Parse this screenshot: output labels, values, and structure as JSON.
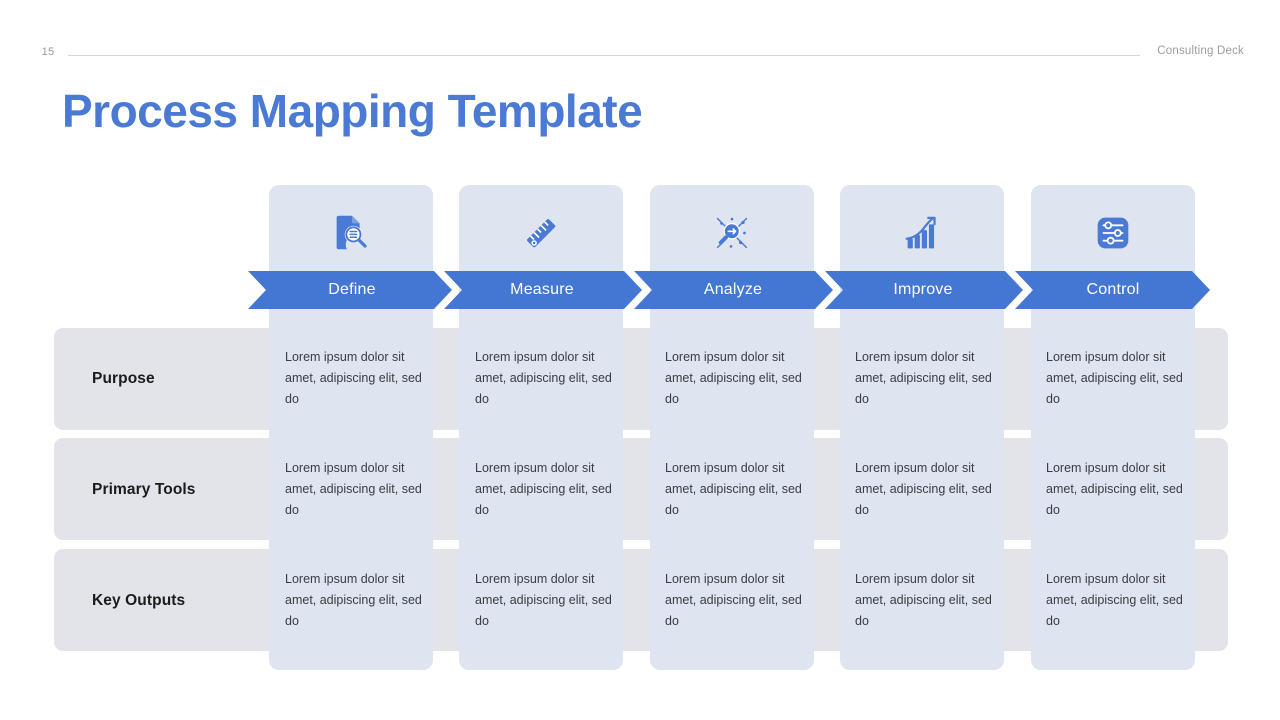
{
  "header": {
    "slide_number": "15",
    "deck_label": "Consulting Deck"
  },
  "title": "Process Mapping Template",
  "colors": {
    "title_blue": "#4a7ad4",
    "chevron_blue": "#4477d4",
    "column_card": "#dfe4f1",
    "row_band": "#e2e4ea",
    "icon_blue": "#4a7ad4",
    "body_text": "#3a3c41",
    "label_text": "#1b1b1b",
    "muted_text": "#9d9d9d"
  },
  "phases": [
    {
      "label": "Define",
      "icon": "document-search-icon"
    },
    {
      "label": "Measure",
      "icon": "ruler-icon"
    },
    {
      "label": "Analyze",
      "icon": "data-analysis-icon"
    },
    {
      "label": "Improve",
      "icon": "growth-chart-icon"
    },
    {
      "label": "Control",
      "icon": "sliders-settings-icon"
    }
  ],
  "rows": [
    {
      "label": "Purpose",
      "cells": [
        "Lorem ipsum dolor sit amet, adipiscing elit, sed do",
        "Lorem ipsum dolor sit amet, adipiscing elit, sed do",
        "Lorem ipsum dolor sit amet, adipiscing elit, sed do",
        "Lorem ipsum dolor sit amet, adipiscing elit, sed do",
        "Lorem ipsum dolor sit amet, adipiscing elit, sed do"
      ]
    },
    {
      "label": "Primary Tools",
      "cells": [
        "Lorem ipsum dolor sit amet, adipiscing elit, sed do",
        "Lorem ipsum dolor sit amet, adipiscing elit, sed do",
        "Lorem ipsum dolor sit amet, adipiscing elit, sed do",
        "Lorem ipsum dolor sit amet, adipiscing elit, sed do",
        "Lorem ipsum dolor sit amet, adipiscing elit, sed do"
      ]
    },
    {
      "label": "Key Outputs",
      "cells": [
        "Lorem ipsum dolor sit amet, adipiscing elit, sed do",
        "Lorem ipsum dolor sit amet, adipiscing elit, sed do",
        "Lorem ipsum dolor sit amet, adipiscing elit, sed do",
        "Lorem ipsum dolor sit amet, adipiscing elit, sed do",
        "Lorem ipsum dolor sit amet, adipiscing elit, sed do"
      ]
    }
  ]
}
